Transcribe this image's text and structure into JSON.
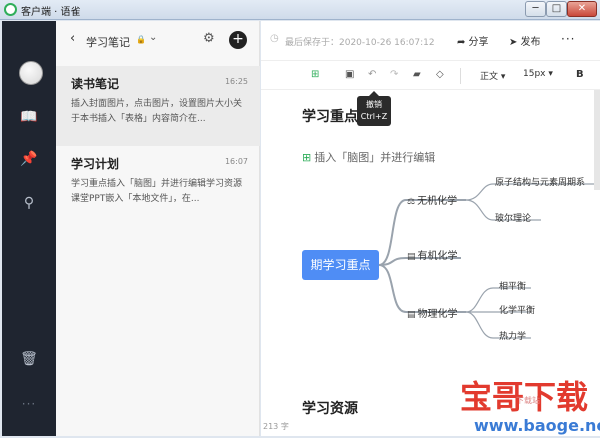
{
  "window": {
    "title": "客户端 · 语雀",
    "min": "─",
    "max": "□",
    "close": "✕"
  },
  "rail": {
    "icons": [
      "book-icon",
      "pin-icon",
      "search-icon",
      "trash-icon"
    ],
    "book": "📖",
    "pin": "📌",
    "search": "⚲",
    "trash": "🗑",
    "more": "···"
  },
  "list": {
    "back": "‹",
    "notebook_title": "学习笔记",
    "lock": "🔒",
    "chevron": "⌄",
    "gear": "⚙",
    "add": "+",
    "notes": [
      {
        "title": "读书笔记",
        "time": "16:25",
        "snippet": "插入封面图片，点击图片，设置图片大小关于本书插入「表格」内容简介在..."
      },
      {
        "title": "学习计划",
        "time": "16:07",
        "snippet": "学习重点插入「脑图」并进行编辑学习资源课堂PPT嵌入「本地文件」，在..."
      }
    ]
  },
  "editor": {
    "clock": "◷",
    "saved": "最后保存于：2020-10-26 16:07:12",
    "share": "➦ 分享",
    "publish": "➤ 发布",
    "more": "···",
    "toolbar": {
      "mind": "⊞",
      "save": "▣",
      "undo": "↶",
      "redo": "↷",
      "brush": "▰",
      "clear": "◇",
      "font": "正文 ▾",
      "size": "15px ▾",
      "bold": "B"
    },
    "tooltip": {
      "line1": "撤销",
      "line2": "Ctrl+Z"
    },
    "heading_focus": "学习重点",
    "insert_icon": "⊞",
    "insert_hint": "插入「脑图」并进行编辑",
    "heading_resources": "学习资源",
    "word_count": "213 字"
  },
  "mindmap": {
    "root": "期学习重点",
    "branches": [
      {
        "icon": "⚖",
        "label": "无机化学",
        "leaves": [
          "原子结构与元素周期系",
          "玻尔理论"
        ]
      },
      {
        "icon": "▤",
        "label": "有机化学",
        "leaves": []
      },
      {
        "icon": "▤",
        "label": "物理化学",
        "leaves": [
          "相平衡",
          "化学平衡",
          "热力学"
        ]
      }
    ]
  },
  "watermark": {
    "title": "宝哥下载",
    "sub": "下载站",
    "url": "www.baoge.net"
  },
  "colors": {
    "rail": "#1f2530",
    "accent": "#4f8df5",
    "green": "#2fae5a",
    "watermark": "#e23a2e"
  }
}
